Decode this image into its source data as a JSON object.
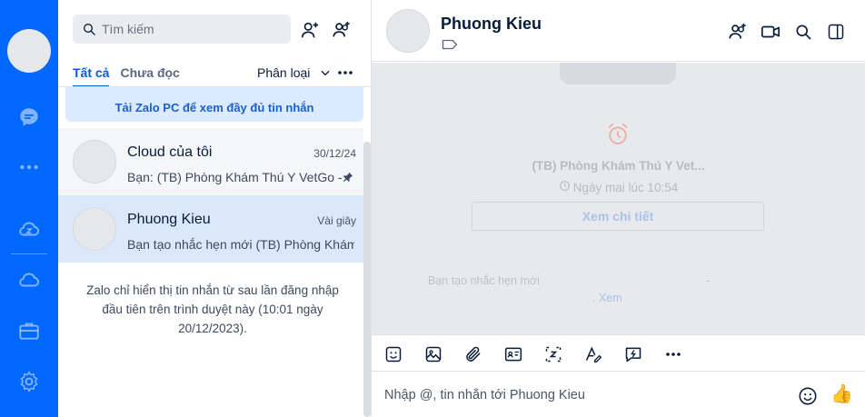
{
  "rail": {
    "icons": [
      "avatar",
      "chat-icon",
      "more-dots-icon",
      "zcloud-icon",
      "cloud-icon",
      "briefcase-icon",
      "settings-icon"
    ],
    "accent": "#0068ff"
  },
  "list": {
    "search_placeholder": "Tìm kiếm",
    "tabs": [
      {
        "label": "Tất cả",
        "active": true
      },
      {
        "label": "Chưa đọc",
        "active": false
      }
    ],
    "classify_label": "Phân loại",
    "banner_text": "Tải Zalo PC để xem đầy đủ tin nhắn",
    "conversations": [
      {
        "name": "Cloud của tôi",
        "time": "30/12/24",
        "preview": "Bạn: (TB) Phòng Khám Thú Y VetGo - ",
        "pinned": true
      },
      {
        "name": "Phuong Kieu",
        "time": "Vài giây",
        "preview": "Bạn tạo nhắc hẹn mới (TB) Phòng Khám",
        "pinned": false
      }
    ],
    "notice": "Zalo chỉ hiển thị tin nhắn từ sau lần đăng nhập đầu tiên trên trình duyệt này (10:01 ngày 20/12/2023)."
  },
  "chat": {
    "contact_name": "Phuong Kieu",
    "reminder": {
      "title": "(TB) Phòng Khám Thú Y  Vet...",
      "time": "Ngày mai lúc 10:54",
      "detail_label": "Xem chi tiết"
    },
    "system_message": "Bạn tạo nhắc hẹn mới",
    "system_dash": "-",
    "system_link": ". Xem",
    "composer_placeholder": "Nhập @, tin nhắn tới Phuong Kieu",
    "like_emoji": "👍"
  }
}
